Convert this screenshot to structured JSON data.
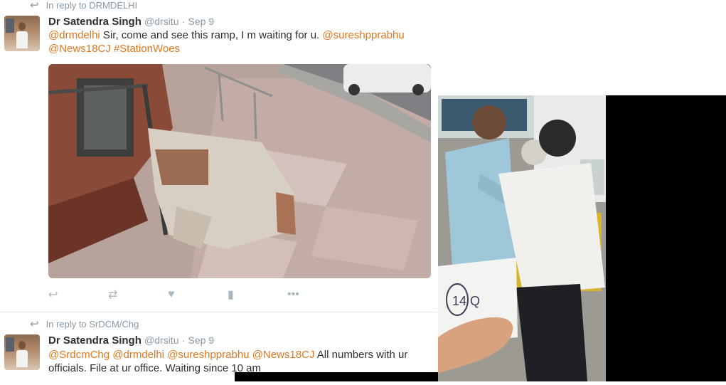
{
  "tweet1": {
    "reply_label": "In reply to DRMDELHI",
    "name": "Dr Satendra Singh",
    "handle": "@drsitu",
    "separator": "·",
    "date": "Sep 9",
    "text": {
      "m1": "@drmdelhi",
      "t1": " Sir, come and see this ramp, I m waiting for u. ",
      "m2": "@sureshpprabhu",
      "m3": "@News18CJ",
      "m4": "#StationWoes"
    }
  },
  "tweet2": {
    "reply_label": "In reply to SrDCM/Chg",
    "name": "Dr Satendra Singh",
    "handle": "@drsitu",
    "separator": "·",
    "date": "Sep 9",
    "text": {
      "m1": "@SrdcmChg",
      "m2": "@drmdelhi",
      "m3": "@sureshpprabhu",
      "m4": "@News18CJ",
      "t1": " All numbers with ur",
      "t2": "officials. File at ur office. Waiting since 10 am"
    }
  },
  "actions": {
    "reply_icon": "↩",
    "retweet_icon": "⇄",
    "like_icon": "♥",
    "analytics_icon": "▮",
    "more_icon": "•••"
  },
  "right_photo": {
    "paper_note": "14 Q"
  },
  "colors": {
    "mention": "#e0771f",
    "muted": "#8899a6",
    "text": "#292f33"
  }
}
